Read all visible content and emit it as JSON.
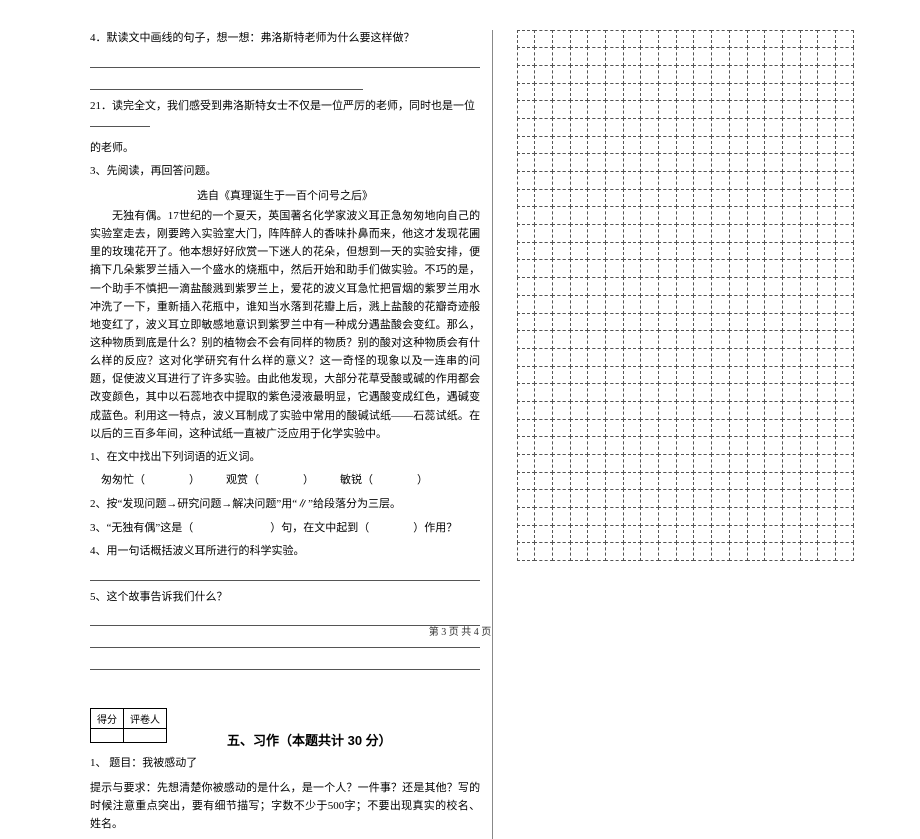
{
  "left": {
    "q4": "4．默读文中画线的句子，想一想：弗洛斯特老师为什么要这样做？",
    "q21_a": "21．读完全文，我们感受到弗洛斯特女士不仅是一位严厉的老师，同时也是一位",
    "q21_b": "的老师。",
    "q3_intro": "3、先阅读，再回答问题。",
    "passage_title": "选自《真理诞生于一百个问号之后》",
    "passage": "无独有偶。17世纪的一个夏天，英国著名化学家波义耳正急匆匆地向自己的实验室走去，刚要跨入实验室大门，阵阵醉人的香味扑鼻而来，他这才发现花圃里的玫瑰花开了。他本想好好欣赏一下迷人的花朵，但想到一天的实验安排，便摘下几朵紫罗兰插入一个盛水的烧瓶中，然后开始和助手们做实验。不巧的是，一个助手不慎把一滴盐酸溅到紫罗兰上，爱花的波义耳急忙把冒烟的紫罗兰用水冲洗了一下，重新插入花瓶中，谁知当水落到花瓣上后，溅上盐酸的花瓣奇迹般地变红了，波义耳立即敏感地意识到紫罗兰中有一种成分遇盐酸会变红。那么，这种物质到底是什么？别的植物会不会有同样的物质？别的酸对这种物质会有什么样的反应？这对化学研究有什么样的意义？这一奇怪的现象以及一连串的问题，促使波义耳进行了许多实验。由此他发现，大部分花草受酸或碱的作用都会改变颜色，其中以石蕊地衣中提取的紫色浸液最明显，它遇酸变成红色，遇碱变成蓝色。利用这一特点，波义耳制成了实验中常用的酸碱试纸——石蕊试纸。在以后的三百多年间，这种试纸一直被广泛应用于化学实验中。",
    "sub1_label": "1、在文中找出下列词语的近义词。",
    "sub1_a": "匆匆忙（　　　　）",
    "sub1_b": "观赏（　　　　）",
    "sub1_c": "敏锐（　　　　）",
    "sub2": "2、按“发现问题→研究问题→解决问题”用“∥”给段落分为三层。",
    "sub3": "3、“无独有偶”这是（　　　　　　　）句，在文中起到（　　　　）作用？",
    "sub4": "4、用一句话概括波义耳所进行的科学实验。",
    "sub5": "5、这个故事告诉我们什么？",
    "section5": "五、习作（本题共计 30 分）",
    "score_a": "得分",
    "score_b": "评卷人",
    "essay_title": "1、 题目：我被感动了",
    "essay_req": "提示与要求：先想清楚你被感动的是什么，是一个人？一件事？还是其他？写的时候注意重点突出，要有细节描写；字数不少于500字；不要出现真实的校名、姓名。"
  },
  "footer": "第 3 页  共 4 页"
}
